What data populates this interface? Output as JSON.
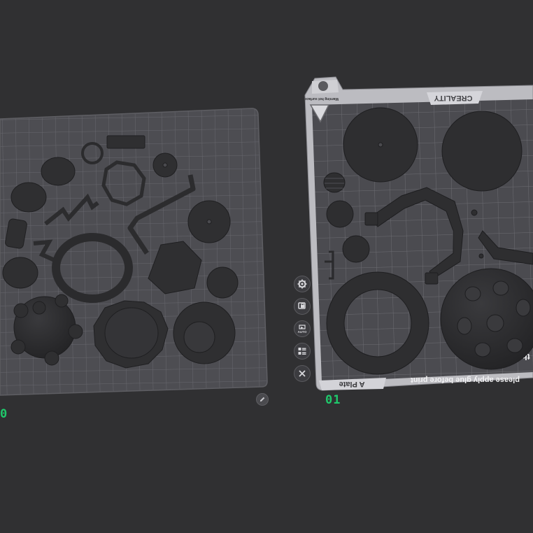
{
  "viewport": {
    "background": "#303032"
  },
  "plates": [
    {
      "index_label": "0",
      "active": false
    },
    {
      "index_label": "01",
      "active": true
    }
  ],
  "build_plate": {
    "brand": "CREALITY",
    "plate_name": "A Plate",
    "warning_note": "please apply glue before print",
    "hot_surface_note": "Warning hot surface",
    "edge_fragment": "th"
  },
  "plate_toolbar": {
    "buttons": [
      {
        "name": "settings-button",
        "icon": "gear-icon"
      },
      {
        "name": "lock-button",
        "icon": "lock-icon"
      },
      {
        "name": "auto-arrange-button",
        "icon": "auto-icon",
        "label": "AUTO"
      },
      {
        "name": "layout-button",
        "icon": "layout-icon"
      },
      {
        "name": "close-button",
        "icon": "close-icon"
      }
    ]
  },
  "colors": {
    "plate_label_green": "#1fc86b",
    "model_gray": "#2f2f31",
    "grid_line": "#6e6e74",
    "plate_frame": "#bdbdc2"
  }
}
